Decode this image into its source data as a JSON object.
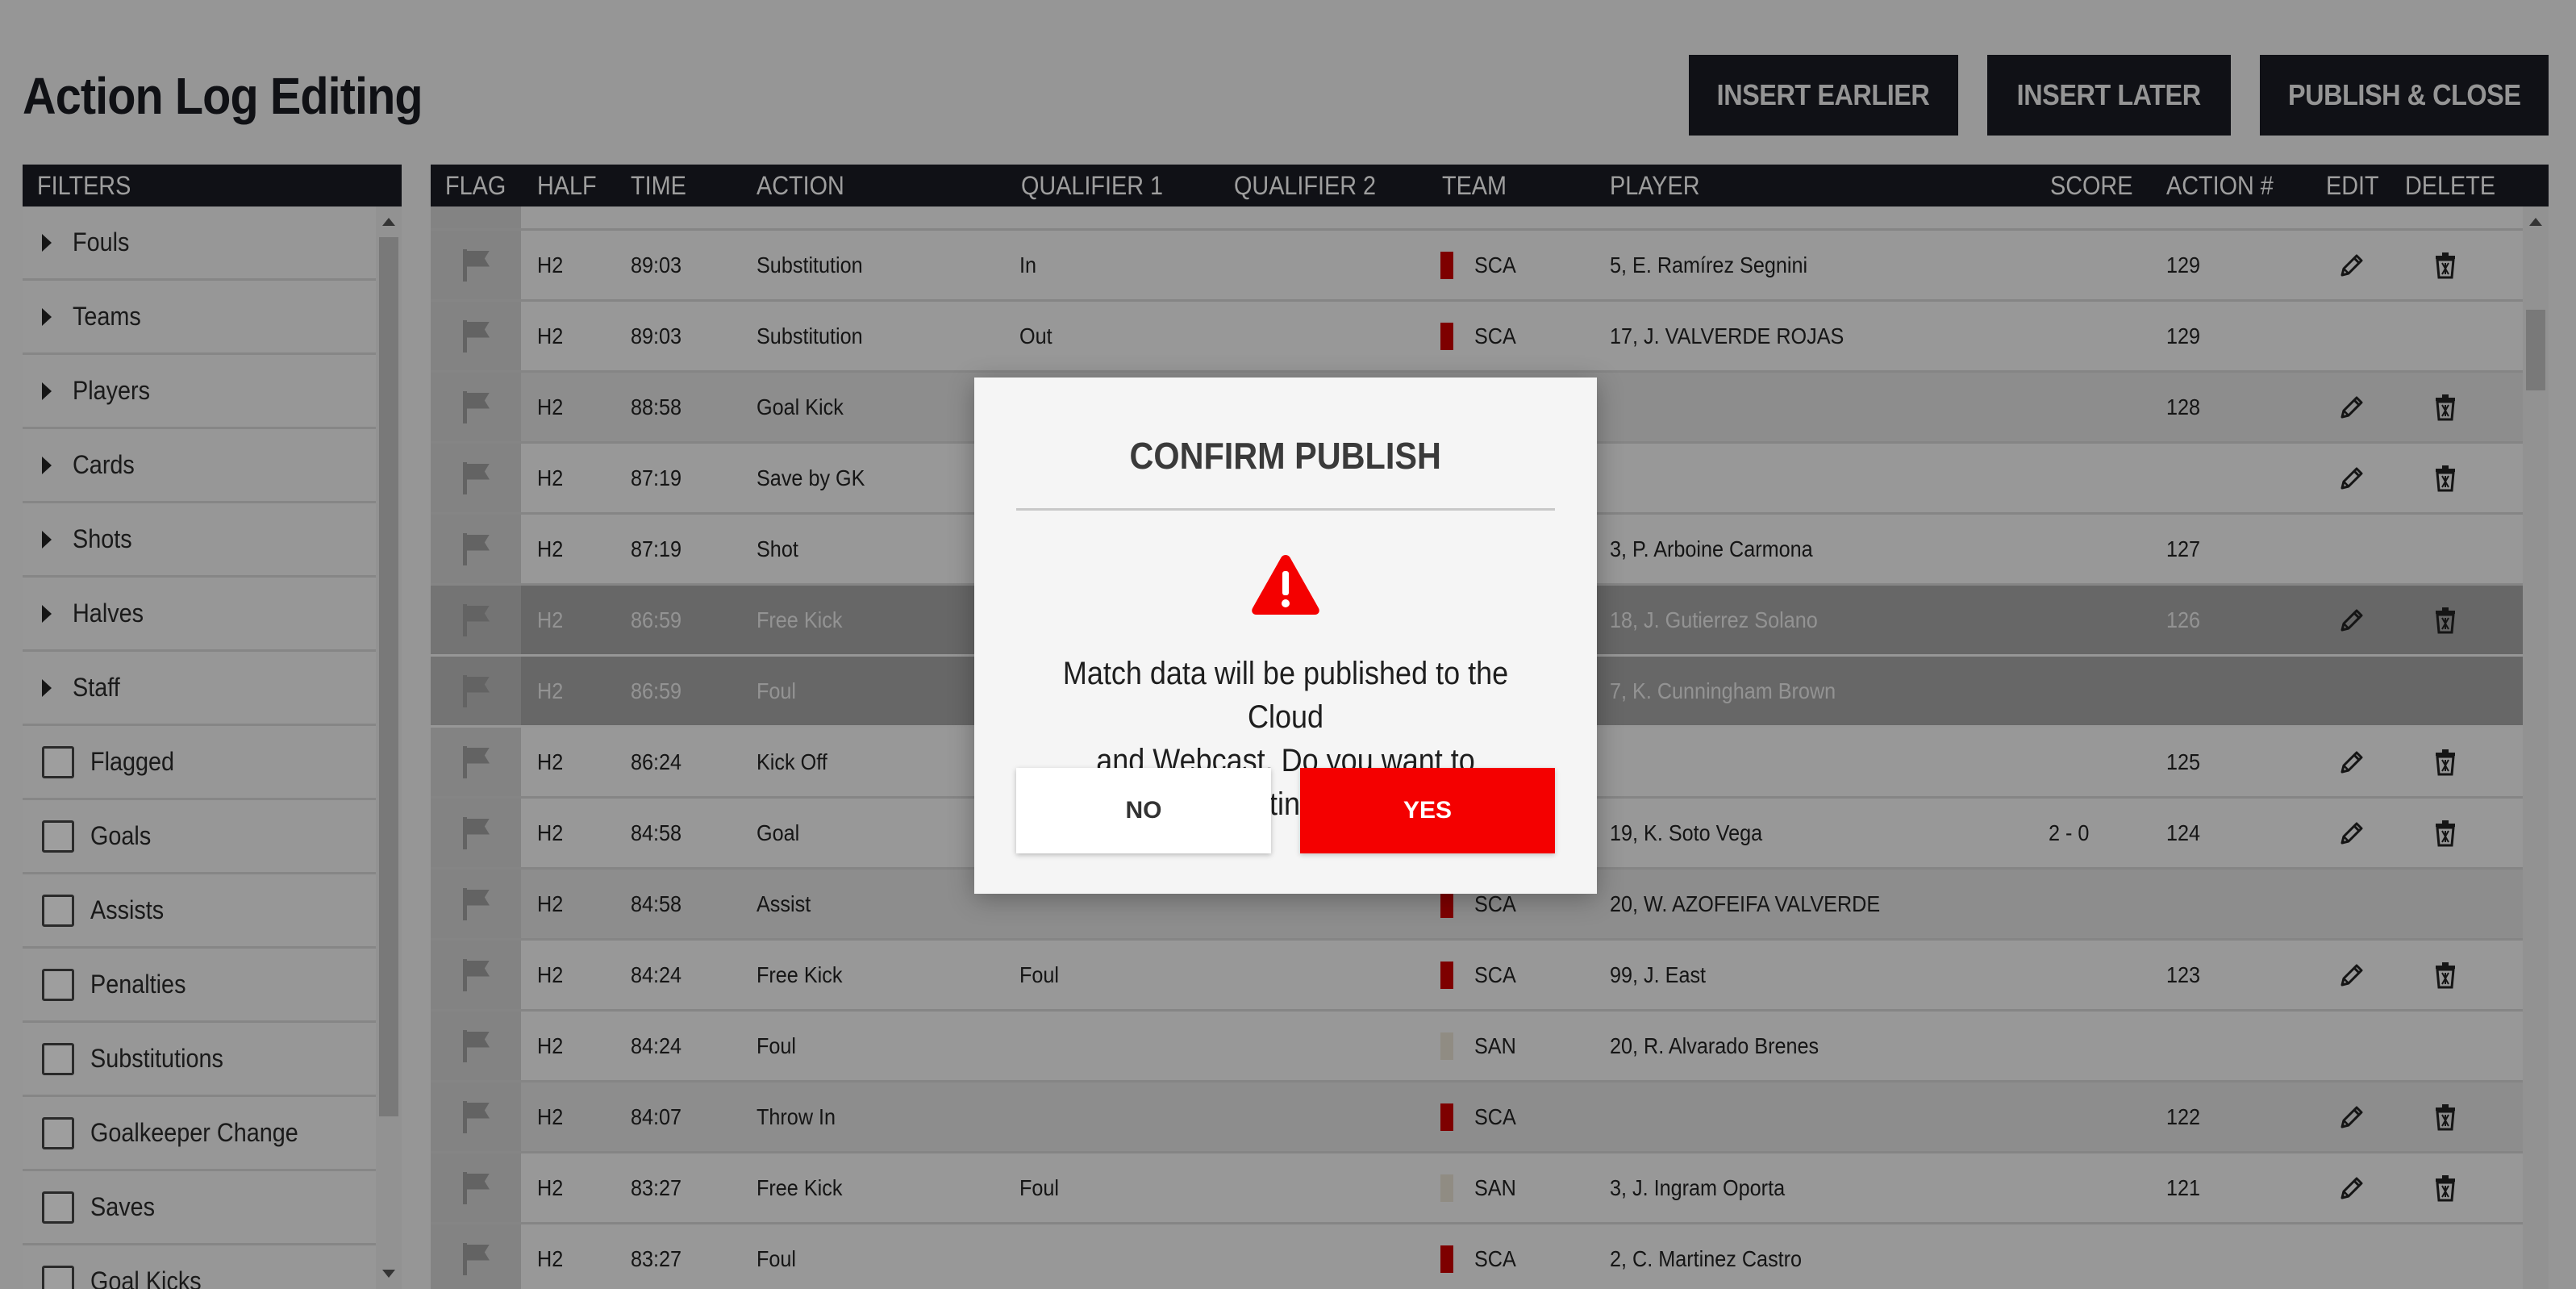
{
  "header": {
    "title": "Action Log Editing",
    "insert_earlier": "INSERT EARLIER",
    "insert_later": "INSERT LATER",
    "publish_close": "PUBLISH & CLOSE"
  },
  "filters": {
    "title": "FILTERS",
    "groups": [
      "Fouls",
      "Teams",
      "Players",
      "Cards",
      "Shots",
      "Halves",
      "Staff"
    ],
    "checkboxes": [
      "Flagged",
      "Goals",
      "Assists",
      "Penalties",
      "Substitutions",
      "Goalkeeper Change",
      "Saves",
      "Goal Kicks"
    ]
  },
  "table": {
    "columns": {
      "flag": "FLAG",
      "half": "HALF",
      "time": "TIME",
      "action": "ACTION",
      "qualifier1": "QUALIFIER 1",
      "qualifier2": "QUALIFIER 2",
      "team": "TEAM",
      "player": "PLAYER",
      "score": "SCORE",
      "action_num": "ACTION #",
      "edit": "EDIT",
      "delete": "DELETE"
    },
    "rows": [
      {
        "half": "H2",
        "time": "89:03",
        "action": "Substitution",
        "q1": "In",
        "q2": "",
        "team": "SCA",
        "team_color": "#cc0000",
        "player": "5, E. Ramírez Segnini",
        "score": "",
        "num": "129",
        "edit": true,
        "del": true,
        "shade": "light"
      },
      {
        "half": "H2",
        "time": "89:03",
        "action": "Substitution",
        "q1": "Out",
        "q2": "",
        "team": "SCA",
        "team_color": "#cc0000",
        "player": "17, J. VALVERDE ROJAS",
        "score": "",
        "num": "129",
        "edit": false,
        "del": false,
        "shade": "light"
      },
      {
        "half": "H2",
        "time": "88:58",
        "action": "Goal Kick",
        "q1": "",
        "q2": "",
        "team": "",
        "team_color": "",
        "player": "",
        "score": "",
        "num": "128",
        "edit": true,
        "del": true,
        "shade": "alt"
      },
      {
        "half": "H2",
        "time": "87:19",
        "action": "Save by GK",
        "q1": "",
        "q2": "",
        "team": "",
        "team_color": "",
        "player": "",
        "score": "",
        "num": "",
        "edit": true,
        "del": true,
        "shade": "light"
      },
      {
        "half": "H2",
        "time": "87:19",
        "action": "Shot",
        "q1": "",
        "q2": "",
        "team": "",
        "team_color": "",
        "player": "3, P. Arboine Carmona",
        "score": "",
        "num": "127",
        "edit": false,
        "del": false,
        "shade": "light"
      },
      {
        "half": "H2",
        "time": "86:59",
        "action": "Free Kick",
        "q1": "",
        "q2": "",
        "team": "",
        "team_color": "",
        "player": "18, J. Gutierrez Solano",
        "score": "",
        "num": "126",
        "edit": true,
        "del": true,
        "shade": "sel"
      },
      {
        "half": "H2",
        "time": "86:59",
        "action": "Foul",
        "q1": "",
        "q2": "",
        "team": "",
        "team_color": "",
        "player": "7, K. Cunningham Brown",
        "score": "",
        "num": "",
        "edit": false,
        "del": false,
        "shade": "sel"
      },
      {
        "half": "H2",
        "time": "86:24",
        "action": "Kick Off",
        "q1": "",
        "q2": "",
        "team": "",
        "team_color": "",
        "player": "",
        "score": "",
        "num": "125",
        "edit": true,
        "del": true,
        "shade": "light"
      },
      {
        "half": "H2",
        "time": "84:58",
        "action": "Goal",
        "q1": "",
        "q2": "",
        "team": "",
        "team_color": "",
        "player": "19, K. Soto Vega",
        "score": "2 - 0",
        "num": "124",
        "edit": true,
        "del": true,
        "shade": "light"
      },
      {
        "half": "H2",
        "time": "84:58",
        "action": "Assist",
        "q1": "",
        "q2": "",
        "team": "SCA",
        "team_color": "#cc0000",
        "player": "20, W. AZOFEIFA VALVERDE",
        "score": "",
        "num": "",
        "edit": false,
        "del": false,
        "shade": "alt"
      },
      {
        "half": "H2",
        "time": "84:24",
        "action": "Free Kick",
        "q1": "Foul",
        "q2": "",
        "team": "SCA",
        "team_color": "#cc0000",
        "player": "99, J. East",
        "score": "",
        "num": "123",
        "edit": true,
        "del": true,
        "shade": "light"
      },
      {
        "half": "H2",
        "time": "84:24",
        "action": "Foul",
        "q1": "",
        "q2": "",
        "team": "SAN",
        "team_color": "#e8e2d4",
        "player": "20, R. Alvarado Brenes",
        "score": "",
        "num": "",
        "edit": false,
        "del": false,
        "shade": "light"
      },
      {
        "half": "H2",
        "time": "84:07",
        "action": "Throw In",
        "q1": "",
        "q2": "",
        "team": "SCA",
        "team_color": "#cc0000",
        "player": "",
        "score": "",
        "num": "122",
        "edit": true,
        "del": true,
        "shade": "alt"
      },
      {
        "half": "H2",
        "time": "83:27",
        "action": "Free Kick",
        "q1": "Foul",
        "q2": "",
        "team": "SAN",
        "team_color": "#e8e2d4",
        "player": "3, J. Ingram Oporta",
        "score": "",
        "num": "121",
        "edit": true,
        "del": true,
        "shade": "light"
      },
      {
        "half": "H2",
        "time": "83:27",
        "action": "Foul",
        "q1": "",
        "q2": "",
        "team": "SCA",
        "team_color": "#cc0000",
        "player": "2, C. Martinez Castro",
        "score": "",
        "num": "",
        "edit": false,
        "del": false,
        "shade": "light"
      }
    ]
  },
  "modal": {
    "title": "CONFIRM PUBLISH",
    "message_line1": "Match data will be published to the Cloud",
    "message_line2": "and Webcast. Do you want to continue?",
    "no_label": "NO",
    "yes_label": "YES",
    "icon": "warning-icon",
    "accent": "#f40000"
  }
}
